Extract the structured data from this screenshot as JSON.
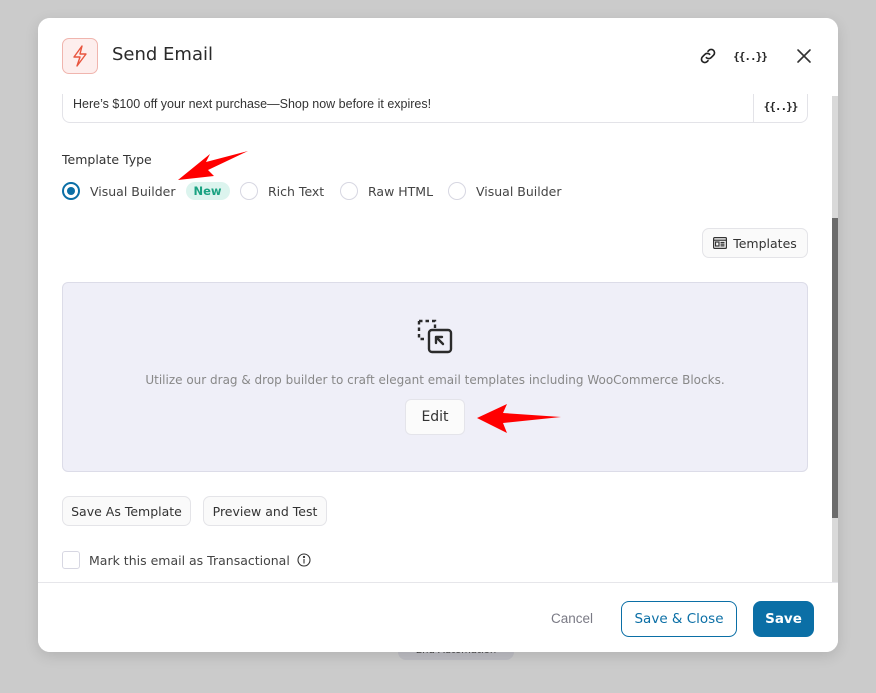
{
  "background": {
    "flow_node_label": "End Automation"
  },
  "modal": {
    "title": "Send Email",
    "header_icon": "lightning-icon",
    "header_actions": {
      "link_icon": "link-icon",
      "merge_tags_label": "{{..}}",
      "close_icon": "close-icon"
    }
  },
  "subject": {
    "value": "Here’s $100 off your next purchase—Shop now before it expires!",
    "merge_tags_label": "{{..}}"
  },
  "template_type": {
    "label": "Template Type",
    "options": [
      {
        "label": "Visual Builder",
        "selected": true,
        "badge": "New"
      },
      {
        "label": "Rich Text",
        "selected": false
      },
      {
        "label": "Raw HTML",
        "selected": false
      },
      {
        "label": "Visual Builder",
        "selected": false
      }
    ]
  },
  "templates_button": {
    "label": "Templates",
    "icon": "template-icon"
  },
  "builder": {
    "icon": "drag-drop-icon",
    "description": "Utilize our drag & drop builder to craft elegant email templates including WooCommerce Blocks.",
    "edit_label": "Edit"
  },
  "actions": {
    "save_as_template": "Save As Template",
    "preview_and_test": "Preview and Test"
  },
  "transactional": {
    "label": "Mark this email as Transactional",
    "checked": false
  },
  "footer": {
    "cancel": "Cancel",
    "save_close": "Save & Close",
    "save": "Save"
  },
  "colors": {
    "primary": "#0b6fa6",
    "badge_bg": "#dcf4ee",
    "badge_text": "#1aa281",
    "header_icon_color": "#e8553e",
    "annotation_arrow": "#ff0000",
    "builder_bg": "#efeff8"
  },
  "scroll": {
    "position_fraction": 0.3
  }
}
